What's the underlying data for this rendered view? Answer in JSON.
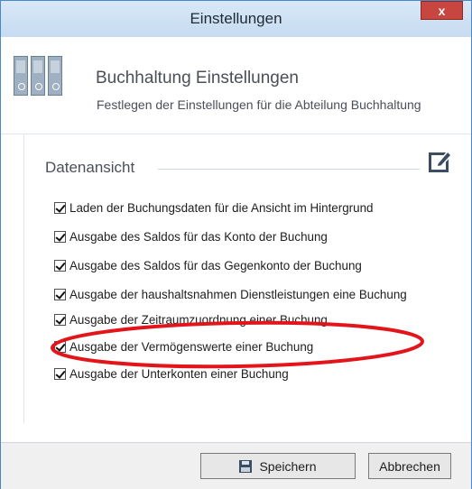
{
  "window": {
    "title": "Einstellungen",
    "close_label": "x"
  },
  "header": {
    "title": "Buchhaltung Einstellungen",
    "subtitle": "Festlegen der Einstellungen für die Abteilung Buchhaltung",
    "icon": "binders-icon"
  },
  "section": {
    "title": "Datenansicht",
    "edit_icon": "edit-icon"
  },
  "options": [
    {
      "label": "Laden der Buchungsdaten für die Ansicht im Hintergrund",
      "checked": true
    },
    {
      "label": "Ausgabe des Saldos für das Konto der Buchung",
      "checked": true
    },
    {
      "label": "Ausgabe des Saldos für das Gegenkonto der Buchung",
      "checked": true
    },
    {
      "label": "Ausgabe der haushaltsnahmen Dienstleistungen eine Buchung",
      "checked": true
    },
    {
      "label": "Ausgabe der Zeitraumzuordnung einer Buchung",
      "checked": true
    },
    {
      "label": "Ausgabe der Vermögenswerte einer Buchung",
      "checked": true
    },
    {
      "label": "Ausgabe der Unterkonten einer Buchung",
      "checked": true
    }
  ],
  "footer": {
    "save_label": "Speichern",
    "cancel_label": "Abbrechen",
    "save_icon": "floppy-disk-icon"
  },
  "colors": {
    "highlight": "#e3151a",
    "titlebar": "#c6dbf1",
    "close": "#c7463f"
  }
}
